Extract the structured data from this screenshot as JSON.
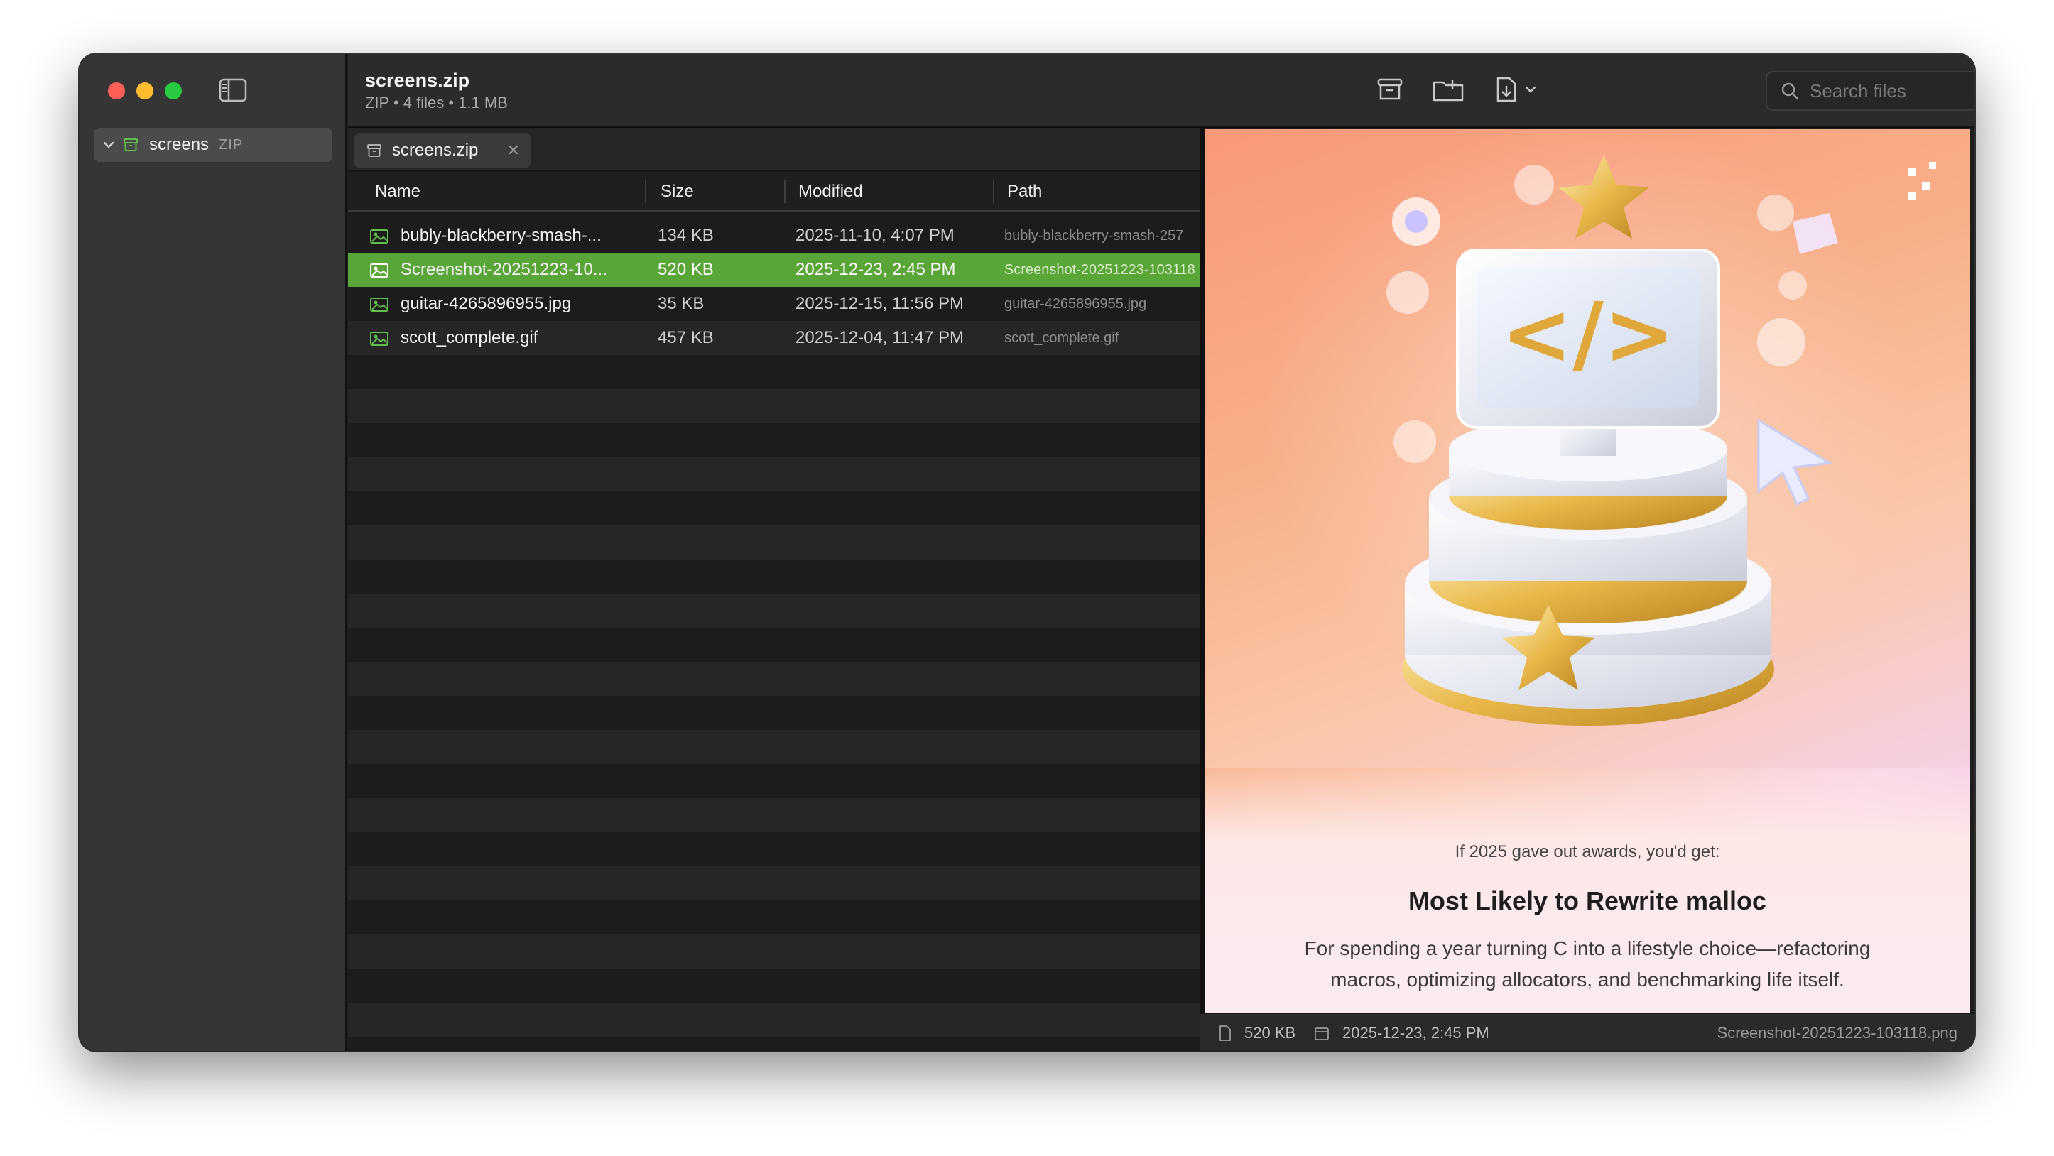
{
  "window": {
    "title": "screens.zip",
    "subtitle": "ZIP • 4 files • 1.1 MB"
  },
  "sidebar": {
    "items": [
      {
        "label": "screens",
        "badge": "ZIP"
      }
    ]
  },
  "toolbar": {
    "search_placeholder": "Search files"
  },
  "tabs": [
    {
      "label": "screens.zip"
    }
  ],
  "table": {
    "columns": [
      "Name",
      "Size",
      "Modified",
      "Path"
    ],
    "rows": [
      {
        "name": "bubly-blackberry-smash-...",
        "size": "134 KB",
        "modified": "2025-11-10, 4:07 PM",
        "path": "bubly-blackberry-smash-257",
        "selected": false
      },
      {
        "name": "Screenshot-20251223-10...",
        "size": "520 KB",
        "modified": "2025-12-23, 2:45 PM",
        "path": "Screenshot-20251223-103118",
        "selected": true
      },
      {
        "name": "guitar-4265896955.jpg",
        "size": "35 KB",
        "modified": "2025-12-15, 11:56 PM",
        "path": "guitar-4265896955.jpg",
        "selected": false
      },
      {
        "name": "scott_complete.gif",
        "size": "457 KB",
        "modified": "2025-12-04, 11:47 PM",
        "path": "scott_complete.gif",
        "selected": false
      }
    ]
  },
  "preview": {
    "kicker": "If 2025 gave out awards, you'd get:",
    "title": "Most Likely to Rewrite malloc",
    "description": "For spending a year turning C into a lifestyle choice—refactoring macros, optimizing allocators, and benchmarking life itself.",
    "code_glyph": "</>"
  },
  "statusbar": {
    "size": "520 KB",
    "modified": "2025-12-23, 2:45 PM",
    "filename": "Screenshot-20251223-103118.png"
  },
  "colors": {
    "selection": "#5aa537",
    "close": "#ff5f57",
    "minimize": "#febc2e",
    "zoom": "#28c840",
    "image_icon": "#5fbf4a"
  }
}
